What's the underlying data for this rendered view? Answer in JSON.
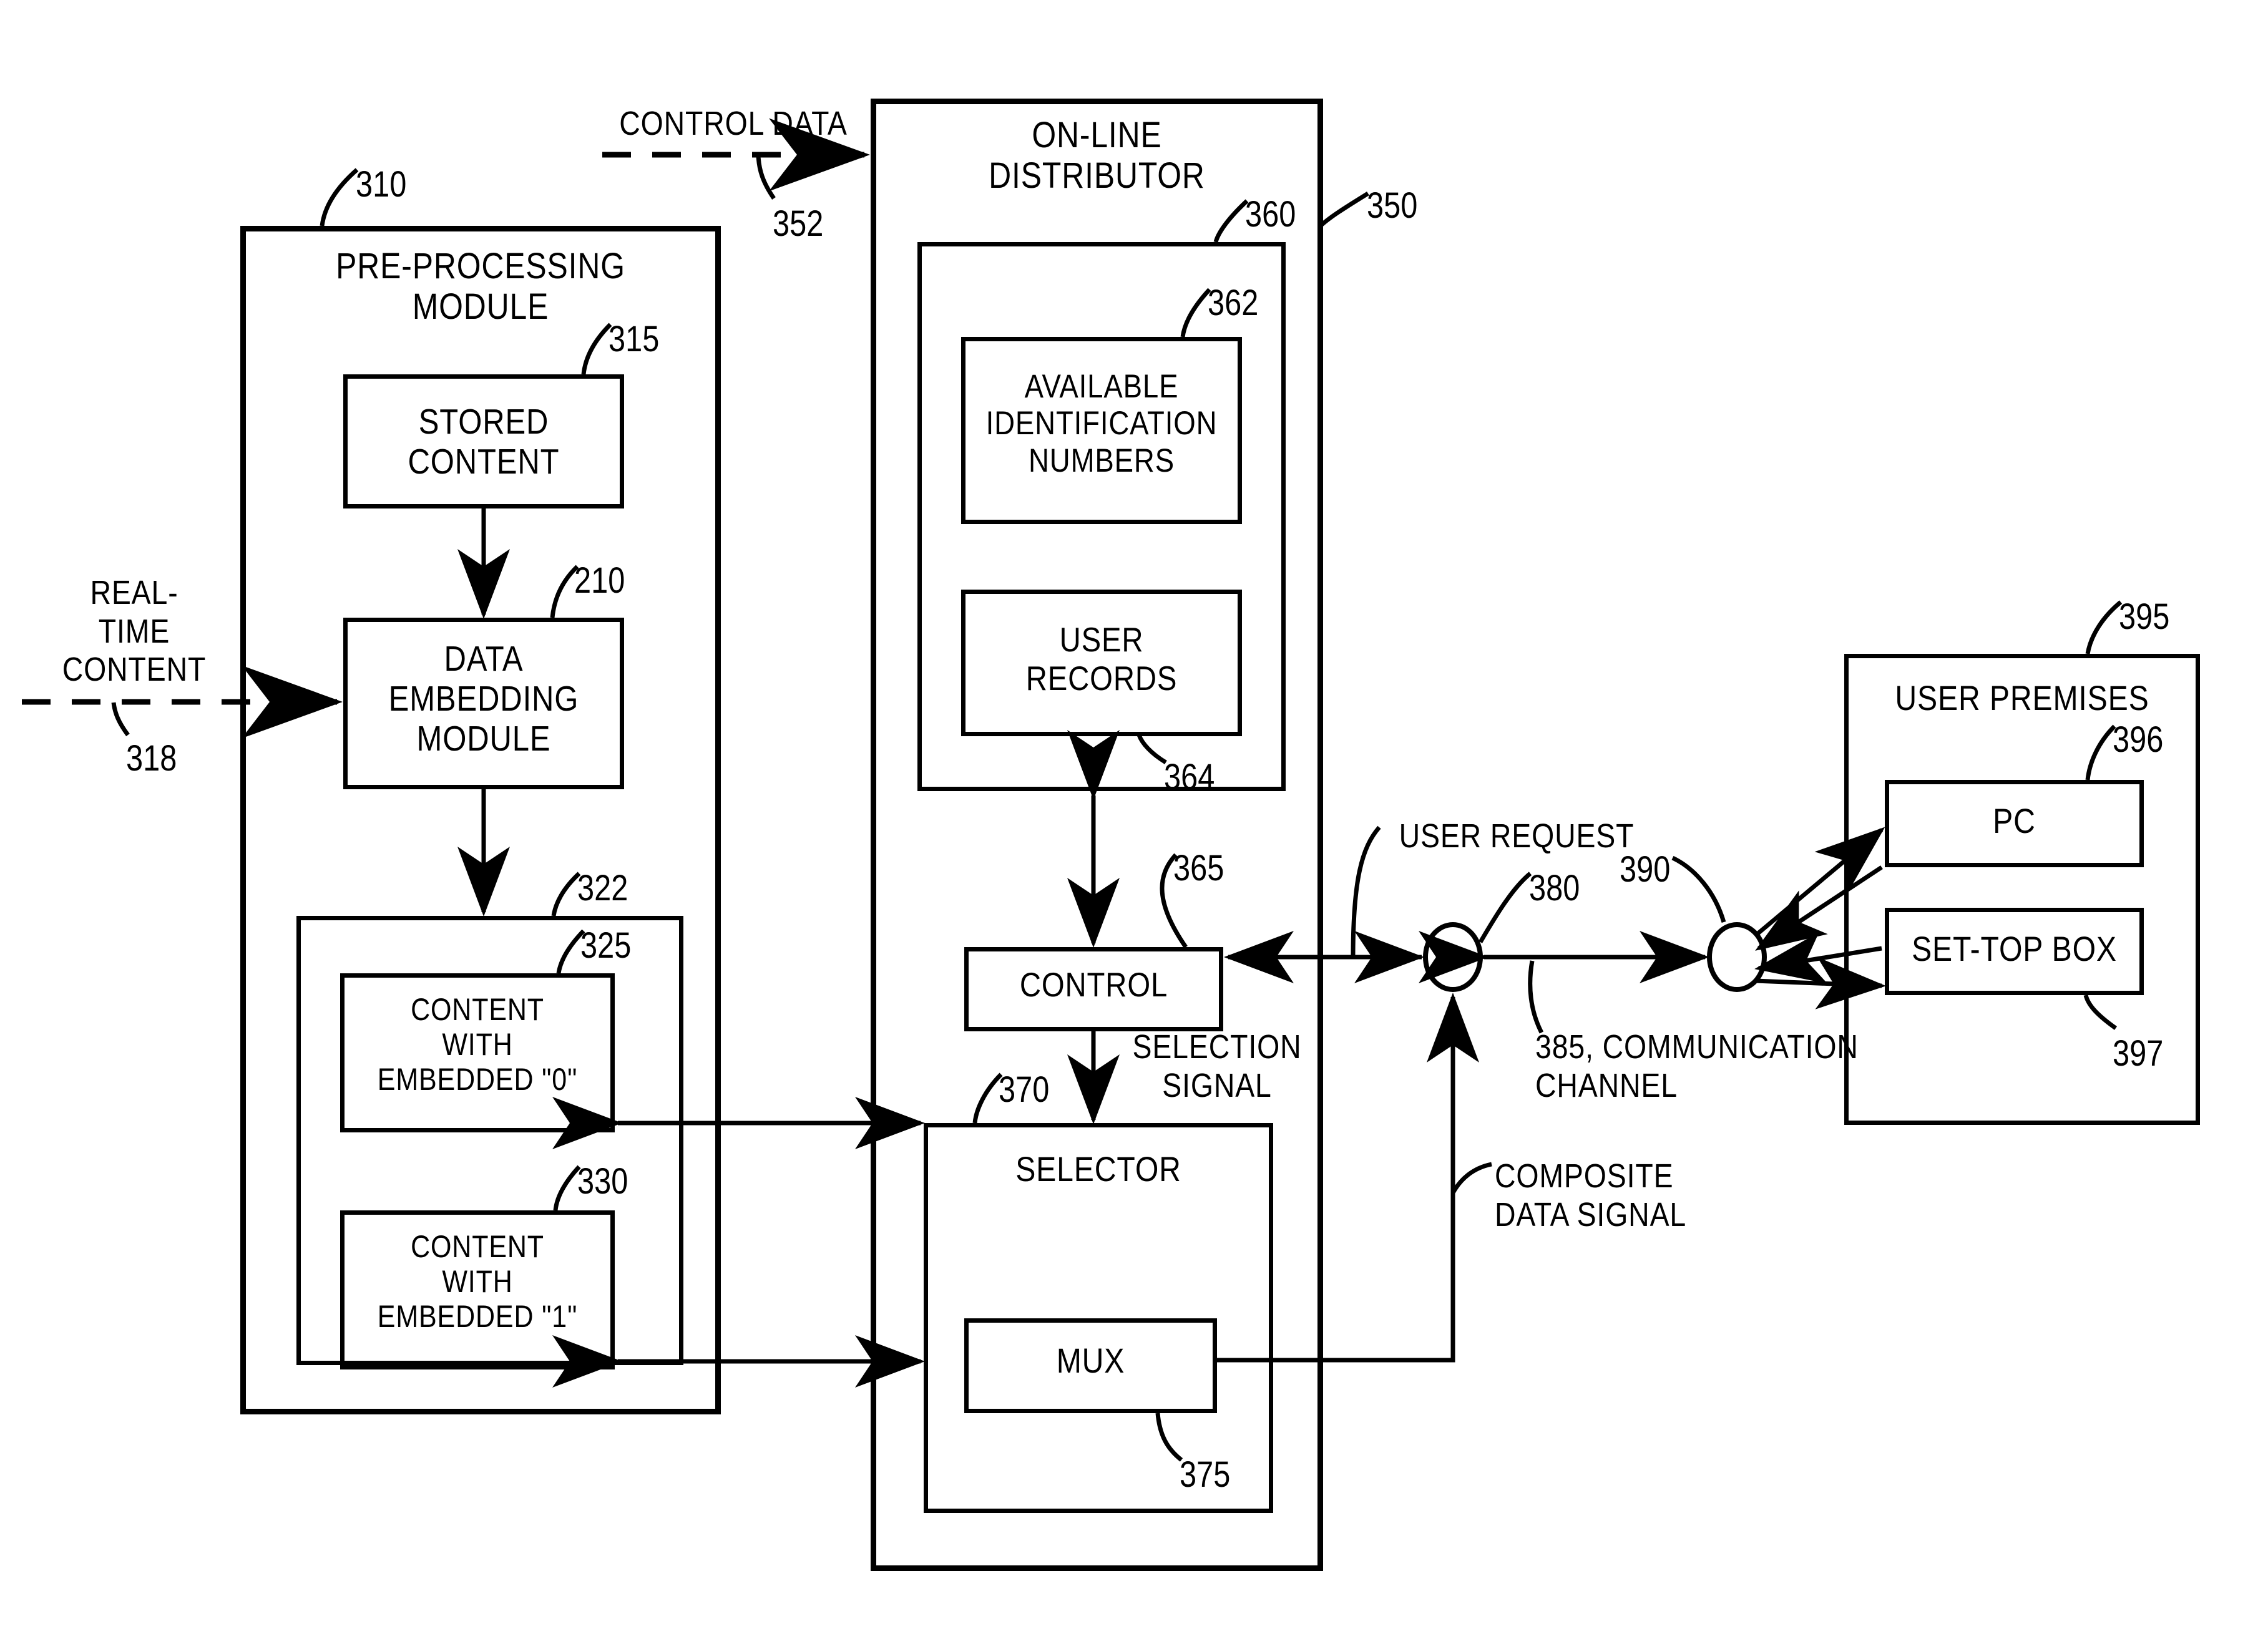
{
  "figure": {
    "type": "patent-block-diagram",
    "background": "#ffffff",
    "stroke": "#000000"
  },
  "signals": {
    "control_data": "CONTROL DATA",
    "control_data_ref": "352",
    "real_time_content": "REAL-\nTIME\nCONTENT",
    "real_time_content_ref": "318",
    "selection_signal": "SELECTION\nSIGNAL",
    "user_request": "USER REQUEST",
    "communication_channel": "385, COMMUNICATION\nCHANNEL",
    "composite_data_signal": "COMPOSITE\nDATA SIGNAL"
  },
  "preprocessing": {
    "title": "PRE-PROCESSING\nMODULE",
    "ref": "310",
    "stored_content": {
      "label": "STORED\nCONTENT",
      "ref": "315"
    },
    "data_embedding": {
      "label": "DATA\nEMBEDDING\nMODULE",
      "ref": "210"
    },
    "content_group": {
      "ref": "322"
    },
    "content_zero": {
      "label": "CONTENT\nWITH\nEMBEDDED  \"0\"",
      "ref": "325"
    },
    "content_one": {
      "label": "CONTENT\nWITH\nEMBEDDED  \"1\"",
      "ref": "330"
    }
  },
  "distributor": {
    "title": "ON-LINE\nDISTRIBUTOR",
    "ref": "350",
    "database_group": {
      "ref": "360"
    },
    "available_ids": {
      "label": "AVAILABLE\nIDENTIFICATION\nNUMBERS",
      "ref": "362"
    },
    "user_records": {
      "label": "USER\nRECORDS",
      "ref": "364"
    },
    "control": {
      "label": "CONTROL",
      "ref": "365"
    },
    "selector": {
      "label": "SELECTOR",
      "ref": "370"
    },
    "mux": {
      "label": "MUX",
      "ref": "375"
    }
  },
  "network": {
    "node_request": {
      "ref": "380"
    },
    "node_premises": {
      "ref": "390"
    }
  },
  "user_premises": {
    "title": "USER PREMISES",
    "ref": "395",
    "pc": {
      "label": "PC",
      "ref": "396"
    },
    "set_top_box": {
      "label": "SET-TOP BOX",
      "ref": "397"
    }
  }
}
